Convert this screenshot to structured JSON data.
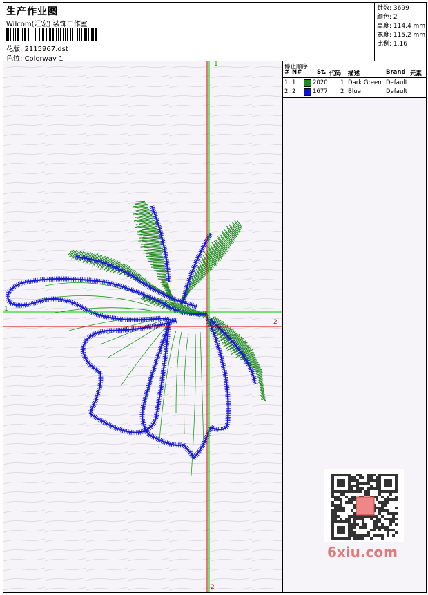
{
  "header": {
    "title": "生产作业图",
    "company": "Wilcom(汇宏) 装饰工作室",
    "pattern_label": "花版:",
    "pattern_value": "2115967.dst",
    "color_label": "色位:",
    "color_value": "Colorway 1"
  },
  "stats": [
    {
      "label": "针数:",
      "value": "3699"
    },
    {
      "label": "颜色:",
      "value": "2"
    },
    {
      "label": "高度:",
      "value": "114.4 mm"
    },
    {
      "label": "宽度:",
      "value": "115.2 mm"
    },
    {
      "label": "比例:",
      "value": "1.16"
    }
  ],
  "stop_sequence": {
    "title": "停止顺序:",
    "columns": [
      "#",
      "N#",
      "St.",
      "代码",
      "描述",
      "Brand",
      "元素"
    ],
    "rows": [
      {
        "index": "1.",
        "n": "1",
        "st": "2020",
        "code": "1",
        "desc": "Dark Green",
        "brand": "Default",
        "color": "#1f8a1f"
      },
      {
        "index": "2.",
        "n": "2",
        "st": "1677",
        "code": "2",
        "desc": "Blue",
        "brand": "Default",
        "color": "#1010d0"
      }
    ]
  },
  "axes": {
    "top_label": "1",
    "bottom_label": "2",
    "left_label": "1",
    "right_label": "2"
  },
  "watermark": "6xiu.com",
  "colors": {
    "green": "#1f8a1f",
    "blue": "#1818d8",
    "red_axis": "#d00000",
    "green_axis": "#00cc00"
  }
}
